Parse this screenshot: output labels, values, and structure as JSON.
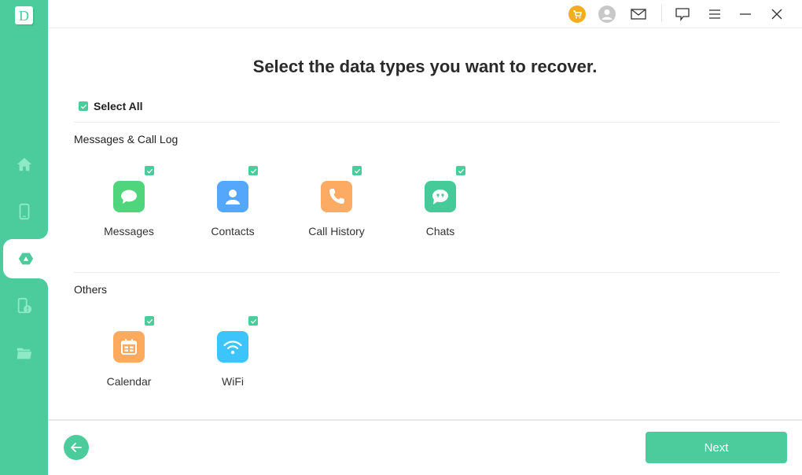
{
  "app": {
    "logo_letter": "D"
  },
  "sidebar": {
    "items": [
      {
        "name": "home",
        "icon": "home-icon",
        "active": false
      },
      {
        "name": "phone",
        "icon": "phone-icon",
        "active": false
      },
      {
        "name": "google-drive",
        "icon": "google-drive-icon",
        "active": true
      },
      {
        "name": "phone-alert",
        "icon": "phone-alert-icon",
        "active": false
      },
      {
        "name": "folder",
        "icon": "folder-icon",
        "active": false
      }
    ]
  },
  "topbar": {
    "icons": [
      "cart-icon",
      "user-icon",
      "mail-icon",
      "feedback-icon",
      "menu-icon",
      "minimize-icon",
      "close-icon"
    ],
    "colors": {
      "cart": "#f5ad1b",
      "user": "#c8c8c8"
    }
  },
  "main": {
    "title": "Select the data types you want to recover.",
    "select_all": {
      "label": "Select All",
      "checked": true
    },
    "sections": [
      {
        "label": "Messages & Call Log",
        "items": [
          {
            "label": "Messages",
            "icon": "message-bubble-icon",
            "color": "#4fd67c",
            "checked": true
          },
          {
            "label": "Contacts",
            "icon": "person-icon",
            "color": "#55a7fb",
            "checked": true
          },
          {
            "label": "Call History",
            "icon": "phone-handset-icon",
            "color": "#fdaa62",
            "checked": true
          },
          {
            "label": "Chats",
            "icon": "chat-quote-icon",
            "color": "#45cb99",
            "checked": true
          }
        ]
      },
      {
        "label": "Others",
        "items": [
          {
            "label": "Calendar",
            "icon": "calendar-icon",
            "color": "#fdaa5e",
            "checked": true
          },
          {
            "label": "WiFi",
            "icon": "wifi-icon",
            "color": "#3dc4fb",
            "checked": true
          }
        ]
      }
    ]
  },
  "footer": {
    "back_icon": "arrow-left-icon",
    "next_label": "Next"
  },
  "colors": {
    "accent": "#4ccc9c",
    "sidebar_icon": "#8eeac6"
  }
}
